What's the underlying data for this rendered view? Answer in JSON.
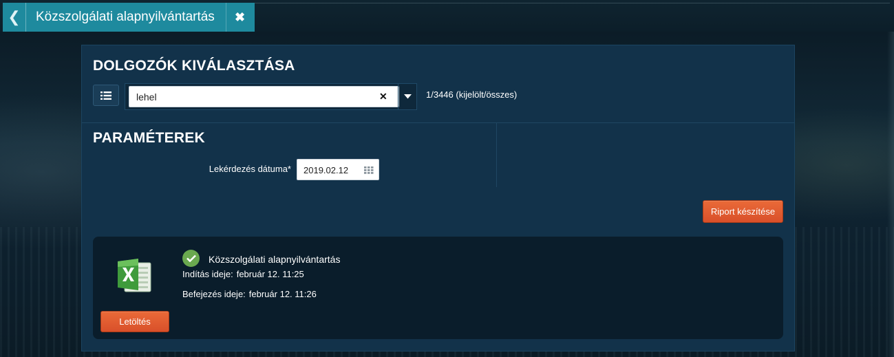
{
  "window": {
    "tab_title": "Közszolgálati alapnyilvántartás",
    "back_icon": "chevron-left-icon",
    "close_icon": "close-icon"
  },
  "selection": {
    "title": "DOLGOZÓK KIVÁLASZTÁSA",
    "list_icon": "list-icon",
    "search_value": "lehel",
    "clear_label": "✕",
    "dropdown_icon": "caret-down-icon",
    "count_text": "1/3446 (kijelölt/összes)"
  },
  "parameters": {
    "title": "PARAMÉTEREK",
    "date_label": "Lekérdezés dátuma*",
    "date_value": "2019.02.12",
    "calendar_icon": "calendar-icon"
  },
  "actions": {
    "report_button": "Riport készítése"
  },
  "result": {
    "file_icon": "excel-icon",
    "status_icon": "check-circle-icon",
    "status_color": "#6aa84f",
    "name": "Közszolgálati alapnyilvántartás",
    "start_label": "Indítás ideje:",
    "start_value": "február 12. 11:25",
    "end_label": "Befejezés ideje:",
    "end_value": "február 12. 11:26",
    "download_button": "Letöltés"
  },
  "colors": {
    "accent_teal": "#1e8a9e",
    "panel": "#12324a",
    "button_orange": "#e0592f"
  }
}
